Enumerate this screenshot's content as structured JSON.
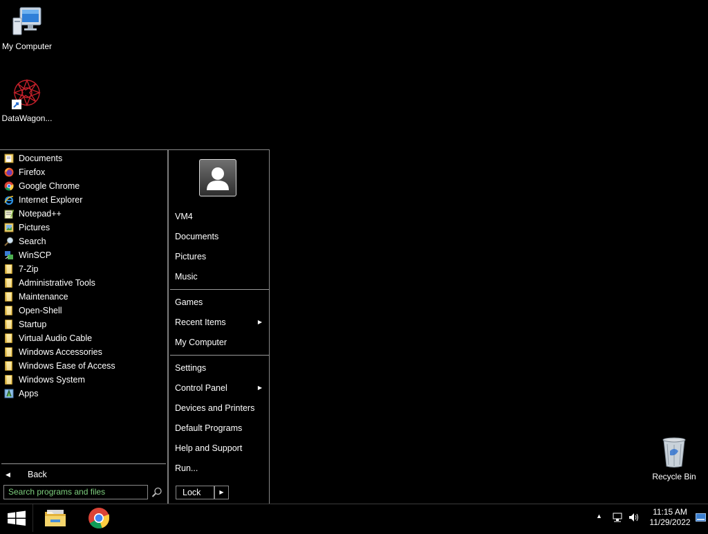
{
  "desktop": {
    "icons": [
      {
        "label": "My Computer",
        "icon": "computer-icon"
      },
      {
        "label": "DataWagon...",
        "icon": "datawagon-shortcut-icon"
      },
      {
        "label": "Recycle Bin",
        "icon": "recycle-bin-icon"
      }
    ]
  },
  "start_menu": {
    "programs": [
      {
        "label": "Documents",
        "icon": "documents-icon"
      },
      {
        "label": "Firefox",
        "icon": "firefox-icon"
      },
      {
        "label": "Google Chrome",
        "icon": "chrome-icon"
      },
      {
        "label": "Internet Explorer",
        "icon": "ie-icon"
      },
      {
        "label": "Notepad++",
        "icon": "notepadpp-icon"
      },
      {
        "label": "Pictures",
        "icon": "pictures-icon"
      },
      {
        "label": "Search",
        "icon": "search-icon"
      },
      {
        "label": "WinSCP",
        "icon": "winscp-icon"
      },
      {
        "label": "7-Zip",
        "icon": "folder-icon"
      },
      {
        "label": "Administrative Tools",
        "icon": "folder-icon"
      },
      {
        "label": "Maintenance",
        "icon": "folder-icon"
      },
      {
        "label": "Open-Shell",
        "icon": "folder-icon"
      },
      {
        "label": "Startup",
        "icon": "folder-icon"
      },
      {
        "label": "Virtual Audio Cable",
        "icon": "folder-icon"
      },
      {
        "label": "Windows Accessories",
        "icon": "folder-icon"
      },
      {
        "label": "Windows Ease of Access",
        "icon": "folder-icon"
      },
      {
        "label": "Windows System",
        "icon": "folder-icon"
      },
      {
        "label": "Apps",
        "icon": "apps-icon"
      }
    ],
    "back_label": "Back",
    "search_placeholder": "Search programs and files",
    "right": {
      "username": "VM4",
      "documents": "Documents",
      "pictures": "Pictures",
      "music": "Music",
      "games": "Games",
      "recent_items": "Recent Items",
      "my_computer": "My Computer",
      "settings": "Settings",
      "control_panel": "Control Panel",
      "devices_printers": "Devices and Printers",
      "default_programs": "Default Programs",
      "help_support": "Help and Support",
      "run": "Run..."
    },
    "lock_label": "Lock"
  },
  "taskbar": {
    "apps": [
      {
        "name": "file-explorer",
        "icon": "file-explorer-icon"
      },
      {
        "name": "chrome",
        "icon": "chrome-icon"
      }
    ],
    "clock_time": "11:15 AM",
    "clock_date": "11/29/2022"
  }
}
